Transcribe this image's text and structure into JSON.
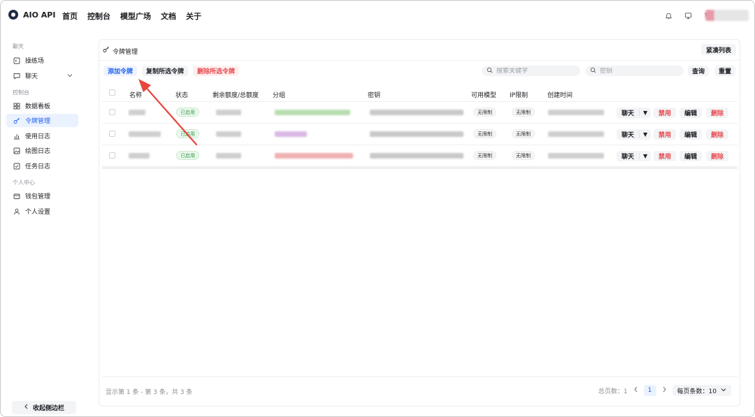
{
  "header": {
    "app_title": "AIO API",
    "nav": [
      "首页",
      "控制台",
      "模型广场",
      "文档",
      "关于"
    ],
    "icons": [
      "bell-icon",
      "monitor-icon",
      "translate-icon"
    ]
  },
  "sidebar": {
    "sections": [
      "聊天",
      "控制台",
      "个人中心"
    ],
    "items": [
      {
        "label": "操练场",
        "icon": "playground-icon"
      },
      {
        "label": "聊天",
        "icon": "chat-icon"
      },
      {
        "label": "数据看板",
        "icon": "dashboard-icon"
      },
      {
        "label": "令牌管理",
        "icon": "key-icon",
        "active": true
      },
      {
        "label": "使用日志",
        "icon": "chart-icon"
      },
      {
        "label": "绘图日志",
        "icon": "image-icon"
      },
      {
        "label": "任务日志",
        "icon": "checklist-icon"
      },
      {
        "label": "钱包管理",
        "icon": "wallet-icon"
      },
      {
        "label": "个人设置",
        "icon": "user-icon"
      }
    ],
    "collapse_label": "收起侧边栏"
  },
  "card": {
    "title": "令牌管理",
    "compact_label": "紧凑列表",
    "add_label": "添加令牌",
    "copy_label": "复制所选令牌",
    "delete_selected_label": "删除所选令牌",
    "search_keyword_placeholder": "搜索关键字",
    "search_key_placeholder": "密钥",
    "query_label": "查询",
    "reset_label": "重置"
  },
  "table": {
    "columns": [
      "名称",
      "状态",
      "剩余额度/总额度",
      "分组",
      "密钥",
      "可用模型",
      "IP限制",
      "创建时间"
    ],
    "rows": [
      {
        "status": "已启用",
        "models": "无限制",
        "ip": "无限制",
        "chat": "聊天",
        "disable": "禁用",
        "edit": "编辑",
        "delete": "删除"
      },
      {
        "status": "已启用",
        "models": "无限制",
        "ip": "无限制",
        "chat": "聊天",
        "disable": "禁用",
        "edit": "编辑",
        "delete": "删除"
      },
      {
        "status": "已启用",
        "models": "无限制",
        "ip": "无限制",
        "chat": "聊天",
        "disable": "禁用",
        "edit": "编辑",
        "delete": "删除"
      }
    ]
  },
  "footer": {
    "info": "显示第 1 条 - 第 3 条，共 3 条",
    "total_pages": "总页数：1",
    "current_page": "1",
    "page_size": "每页条数：10"
  }
}
